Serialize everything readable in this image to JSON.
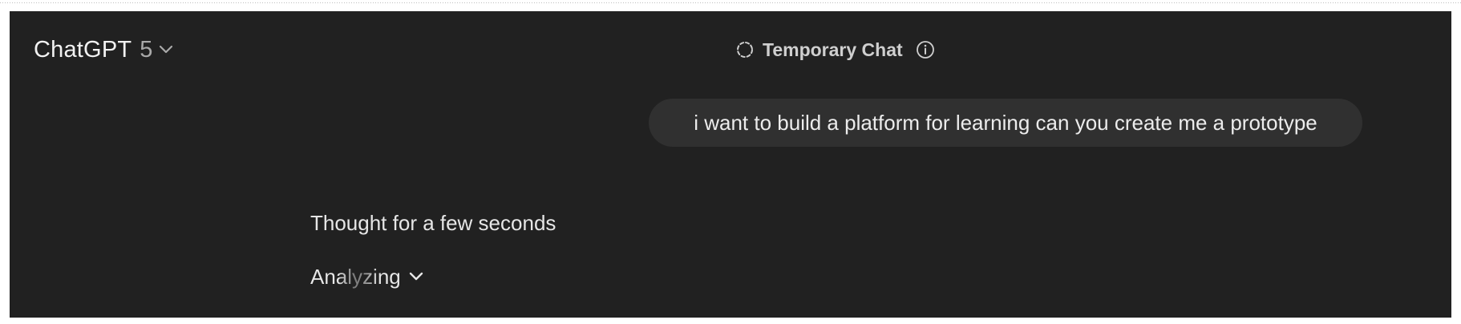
{
  "header": {
    "model_name": "ChatGPT",
    "model_version": "5",
    "model_icon": "chevron-down-icon",
    "temporary_chat_label": "Temporary Chat",
    "temporary_chat_icon": "dashed-circle-icon",
    "info_icon": "info-icon"
  },
  "conversation": {
    "user_message": "i want to build a platform for learning can you create me a prototype",
    "thought_status": "Thought for a few seconds",
    "analyzing_label": "Analyzing",
    "analyzing_icon": "chevron-down-icon"
  },
  "colors": {
    "background": "#212121",
    "bubble": "#303030",
    "text": "#ececec",
    "muted": "#a9a9a9"
  }
}
